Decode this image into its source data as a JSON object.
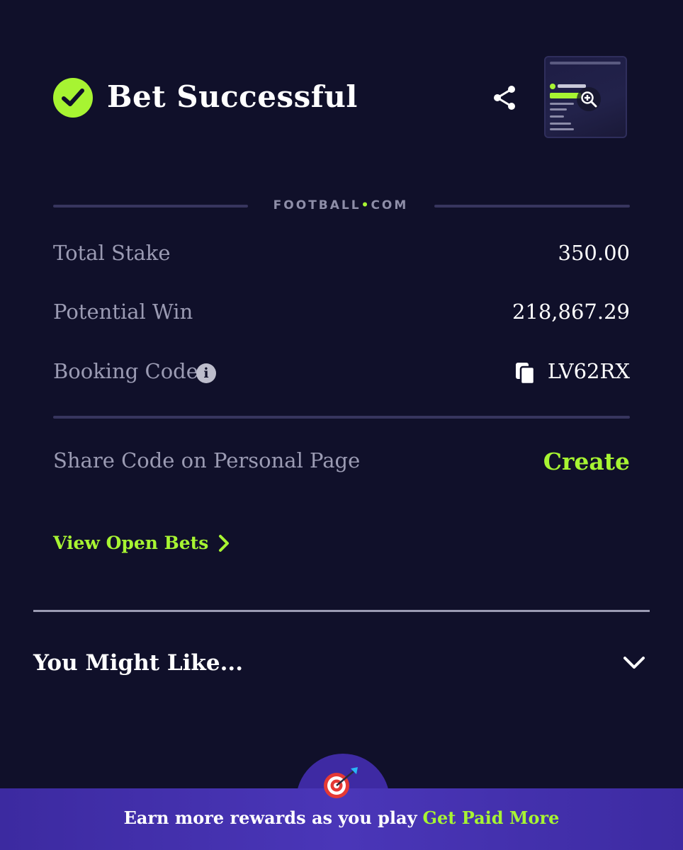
{
  "header": {
    "title": "Bet Successful"
  },
  "brand": {
    "prefix": "FOOTBALL",
    "dot": "•",
    "suffix": "COM"
  },
  "summary": {
    "total_stake_label": "Total Stake",
    "total_stake_value": "350.00",
    "potential_win_label": "Potential Win",
    "potential_win_value": "218,867.29",
    "booking_code_label": "Booking Code",
    "booking_code_value": "LV62RX"
  },
  "share": {
    "label": "Share Code on Personal Page",
    "action": "Create"
  },
  "open_bets_label": "View Open Bets",
  "might_like": {
    "label": "You Might Like..."
  },
  "banner": {
    "text": "Earn more rewards as you play",
    "cta": "Get Paid More"
  },
  "colors": {
    "accent": "#a7f432",
    "background": "#10102a",
    "banner": "#4a36b8"
  },
  "icons": [
    "check-circle-icon",
    "share-icon",
    "zoom-in-icon",
    "info-icon",
    "copy-icon",
    "chevron-right-icon",
    "chevron-down-icon",
    "dart-target-icon"
  ]
}
